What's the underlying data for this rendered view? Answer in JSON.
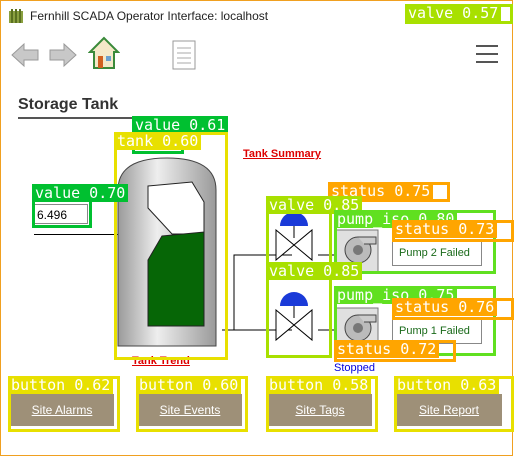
{
  "app": {
    "title": "Fernhill SCADA Operator Interface: localhost",
    "icon": "fernhill-logo-icon"
  },
  "toolbar": {
    "back_icon": "arrow-left-icon",
    "forward_icon": "arrow-right-icon",
    "home_icon": "home-icon",
    "document_icon": "document-icon",
    "menu_icon": "hamburger-menu-icon"
  },
  "page": {
    "heading": "Storage Tank",
    "tank_summary_link": "Tank Summary",
    "tank_trend_link": "Tank Trend",
    "tank_level_value": "6.496",
    "tank_fill_fraction": 0.55
  },
  "pumps": [
    {
      "status": "Pump 2 Failed"
    },
    {
      "status": "Pump 1 Failed"
    }
  ],
  "pump_state": "Stopped",
  "buttons": [
    {
      "label": "Site Alarms"
    },
    {
      "label": "Site Events"
    },
    {
      "label": "Site Tags"
    },
    {
      "label": "Site Report"
    }
  ],
  "annotations": [
    {
      "label": "valve 0.57",
      "color": "#a8e000"
    },
    {
      "label": "value 0.61",
      "color": "#00c030"
    },
    {
      "label": "tank 0.60",
      "color": "#e8e000"
    },
    {
      "label": "value 0.70",
      "color": "#00c030"
    },
    {
      "label": "status 0.75",
      "color": "#ffa500"
    },
    {
      "label": "valve 0.85",
      "color": "#a8e000"
    },
    {
      "label": "pump_iso 0.80",
      "color": "#60e020"
    },
    {
      "label": "status 0.73",
      "color": "#ffa500"
    },
    {
      "label": "valve 0.85",
      "color": "#a8e000"
    },
    {
      "label": "pump_iso 0.75",
      "color": "#60e020"
    },
    {
      "label": "status 0.76",
      "color": "#ffa500"
    },
    {
      "label": "status 0.72",
      "color": "#ffa500"
    },
    {
      "label": "button 0.62",
      "color": "#e8e000"
    },
    {
      "label": "button 0.60",
      "color": "#e8e000"
    },
    {
      "label": "button 0.58",
      "color": "#e8e000"
    },
    {
      "label": "button 0.63",
      "color": "#e8e000"
    }
  ]
}
